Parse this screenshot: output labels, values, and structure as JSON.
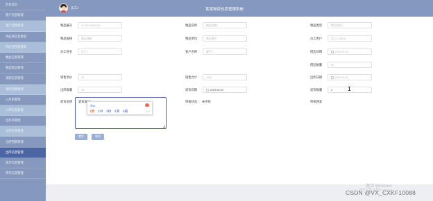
{
  "sidebar": {
    "items": [
      {
        "label": "后台首页"
      },
      {
        "label": "客户信息管理"
      },
      {
        "label": "客户回款管理"
      },
      {
        "label": "供应商信息管理"
      },
      {
        "label": "供应商回款管理"
      },
      {
        "label": "物品信息管理"
      },
      {
        "label": "物品借出管理"
      },
      {
        "label": "采购信息管理"
      },
      {
        "label": "采购回款管理"
      },
      {
        "label": "入库单管理"
      },
      {
        "label": "入库信息管理"
      },
      {
        "label": "出库单管理"
      },
      {
        "label": "出库信息管理"
      },
      {
        "label": "出库回款管理"
      },
      {
        "label": "出库信息管理"
      },
      {
        "label": "盘点信息管理"
      },
      {
        "label": "库存信息管理"
      }
    ]
  },
  "header": {
    "user": "员工1",
    "title": "某某物资仓库管理系统"
  },
  "form": {
    "item_no_label": "物品编号",
    "item_no_value": "1714015929754",
    "item_name_label": "物品名称",
    "item_name_placeholder": "物品名称1",
    "item_type_label": "物品类型",
    "item_type_placeholder": "物品类型1",
    "item_spec_label": "物品规格",
    "item_spec_placeholder": "物品规格",
    "item_unit_label": "物品单位",
    "item_unit_placeholder": "物品单位",
    "employee_user_label": "员工用户",
    "employee_user_placeholder": "员工1-(ASD)",
    "employee_name_label": "员工姓名",
    "employee_name_placeholder": "员工1",
    "customer_name_label": "客户名称",
    "customer_name_placeholder": "客户1",
    "borrow_date_label": "借出日期",
    "borrow_date_value": "2024-05-03",
    "borrow_qty_label": "借出数量",
    "borrow_qty_value": "50",
    "sale_price_label": "销售单价",
    "sale_price_value": "30",
    "sale_total_label": "销售合计",
    "sale_total_value": "1500",
    "outbound_date_label": "出库日期",
    "outbound_date_value": "2024-05-03",
    "outbound_qty_label": "出库数量",
    "outbound_qty_value": "50",
    "return_date_label": "退货日期",
    "return_date_value": "2024-05-03",
    "return_qty_label": "退货数量",
    "return_qty_value": "2",
    "return_reason_label": "退货说明",
    "return_reason_typed": "退货说shu",
    "audit_status_label": "审核状态",
    "audit_status_value": "未审核",
    "audit_reply_label": "审核回复",
    "submit_label": "提交",
    "cancel_label": "取消"
  },
  "ime": {
    "pinyin": "shu",
    "candidates": [
      "1数",
      "2书",
      "3树",
      "4束",
      "5输"
    ],
    "nav": "< >"
  },
  "overlay": {
    "watermark": "激活 Windows",
    "watermark_sub": "转到\"设置\"以激活 Windows。",
    "csdn": "CSDN @VX_CXKF10088"
  },
  "colors": {
    "sidebar": "#8598be",
    "sidebar_active": "#4c66a3",
    "sidebar_alt": "#a9bfd9",
    "button": "#9aafd6"
  }
}
